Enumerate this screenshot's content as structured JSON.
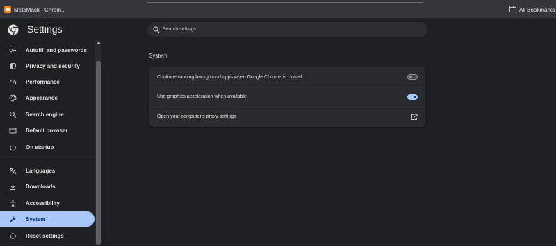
{
  "bookmarks_bar": {
    "tab_title": "MetaMask - Chrom...",
    "all_bookmarks": "All Bookmarks"
  },
  "header": {
    "title": "Settings",
    "search_placeholder": "Search settings"
  },
  "sidebar": {
    "items": [
      {
        "label": "Autofill and passwords",
        "icon": "key-icon"
      },
      {
        "label": "Privacy and security",
        "icon": "shield-icon"
      },
      {
        "label": "Performance",
        "icon": "gauge-icon"
      },
      {
        "label": "Appearance",
        "icon": "palette-icon"
      },
      {
        "label": "Search engine",
        "icon": "search-icon"
      },
      {
        "label": "Default browser",
        "icon": "browser-window-icon"
      },
      {
        "label": "On startup",
        "icon": "power-icon"
      },
      {
        "label": "Languages",
        "icon": "translate-icon"
      },
      {
        "label": "Downloads",
        "icon": "download-icon"
      },
      {
        "label": "Accessibility",
        "icon": "accessibility-icon"
      },
      {
        "label": "System",
        "icon": "wrench-icon",
        "active": true
      },
      {
        "label": "Reset settings",
        "icon": "reset-icon"
      }
    ]
  },
  "main": {
    "section_title": "System",
    "rows": [
      {
        "label": "Continue running background apps when Google Chrome is closed",
        "control": "toggle",
        "enabled": false
      },
      {
        "label": "Use graphics acceleration when available",
        "control": "toggle",
        "enabled": true
      },
      {
        "label": "Open your computer's proxy settings",
        "control": "external-link-icon"
      }
    ]
  },
  "colors": {
    "background": "#1f2023",
    "card": "#2a2b2e",
    "accent": "#a8c7fa",
    "active_text": "#062e6f"
  }
}
